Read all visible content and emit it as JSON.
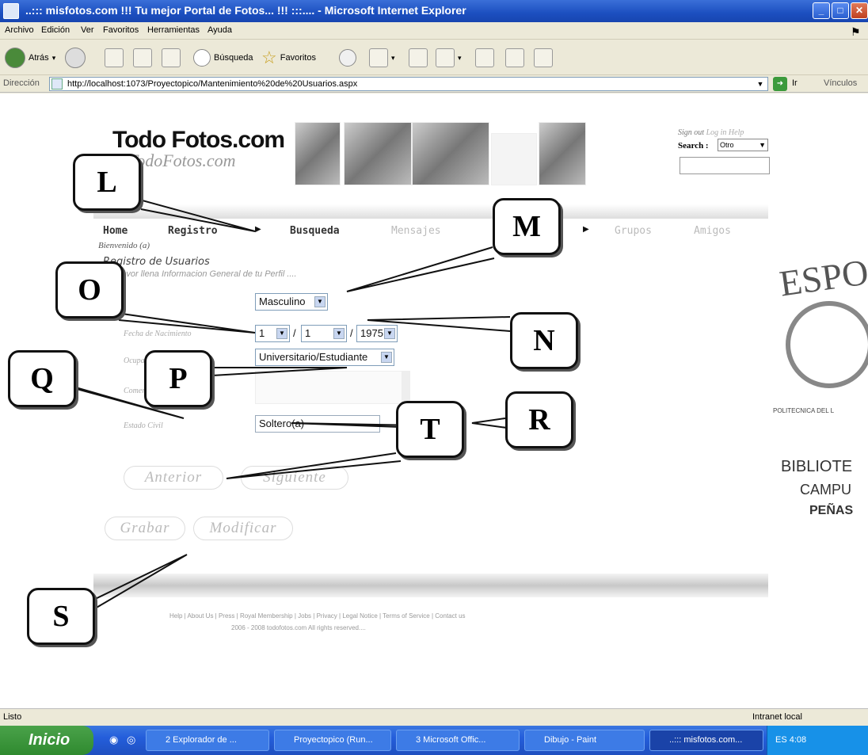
{
  "window": {
    "title": "..::: misfotos.com !!! Tu mejor Portal de Fotos... !!! :::.... - Microsoft Internet Explorer"
  },
  "menu": [
    "Archivo",
    "Edición",
    "Ver",
    "Favoritos",
    "Herramientas",
    "Ayuda"
  ],
  "toolbar": {
    "back": "Atrás",
    "search": "Búsqueda",
    "favorites": "Favoritos"
  },
  "address": {
    "label": "Dirección",
    "url": "http://localhost:1073/Proyectopico/Mantenimiento%20de%20Usuarios.aspx",
    "go": "Ir",
    "links": "Vínculos"
  },
  "site": {
    "logo": "Todo Fotos.com",
    "logo_sub": "TodoFotos.com",
    "sign_out": "Sign out",
    "log_in": "Log in",
    "help": "Help",
    "search_label": "Search :",
    "search_select": "Otro",
    "nav": {
      "home": "Home",
      "registro": "Registro",
      "busqueda": "Busqueda",
      "mensajes": "Mensajes",
      "grupos": "Grupos",
      "amigos": "Amigos"
    },
    "welcome": "Bienvenido (a)",
    "reg_title": "Registro de Usuarios",
    "reg_subtitle": "Por favor llena Informacion General de tu Perfil ....",
    "form": {
      "gender": "Masculino",
      "birth_label": "Fecha de Nacimiento",
      "birth_day": "1",
      "birth_month": "1",
      "birth_year": "1975",
      "occupation_label": "Ocupación",
      "occupation": "Universitario/Estudiante",
      "comment_label": "Comentario",
      "civil_label": "Estado Civil",
      "civil_status": "Soltero(a)"
    },
    "buttons": {
      "previous": "Anterior",
      "next": "Siguiente",
      "save": "Grabar",
      "modify": "Modificar"
    },
    "footer_links": "Help | About Us | Press | Royal Membership | Jobs | Privacy | Legal Notice | Terms of Service | Contact us",
    "footer_copy": "2006 - 2008 todofotos.com All rights reserved...."
  },
  "callouts": [
    "L",
    "M",
    "O",
    "N",
    "Q",
    "P",
    "R",
    "T",
    "S"
  ],
  "stamp": {
    "top": "ESPO",
    "ring": "POLITECNICA DEL L",
    "line1": "BIBLIOTE",
    "line2": "CAMPU",
    "line3": "PEÑAS"
  },
  "status": {
    "left": "Listo",
    "right": "Intranet local"
  },
  "taskbar": {
    "start": "Inicio",
    "tasks": [
      "2 Explorador de ...",
      "Proyectopico (Run...",
      "3 Microsoft Offic...",
      "Dibujo - Paint",
      "..::: misfotos.com..."
    ],
    "tray": "ES  4:08"
  }
}
